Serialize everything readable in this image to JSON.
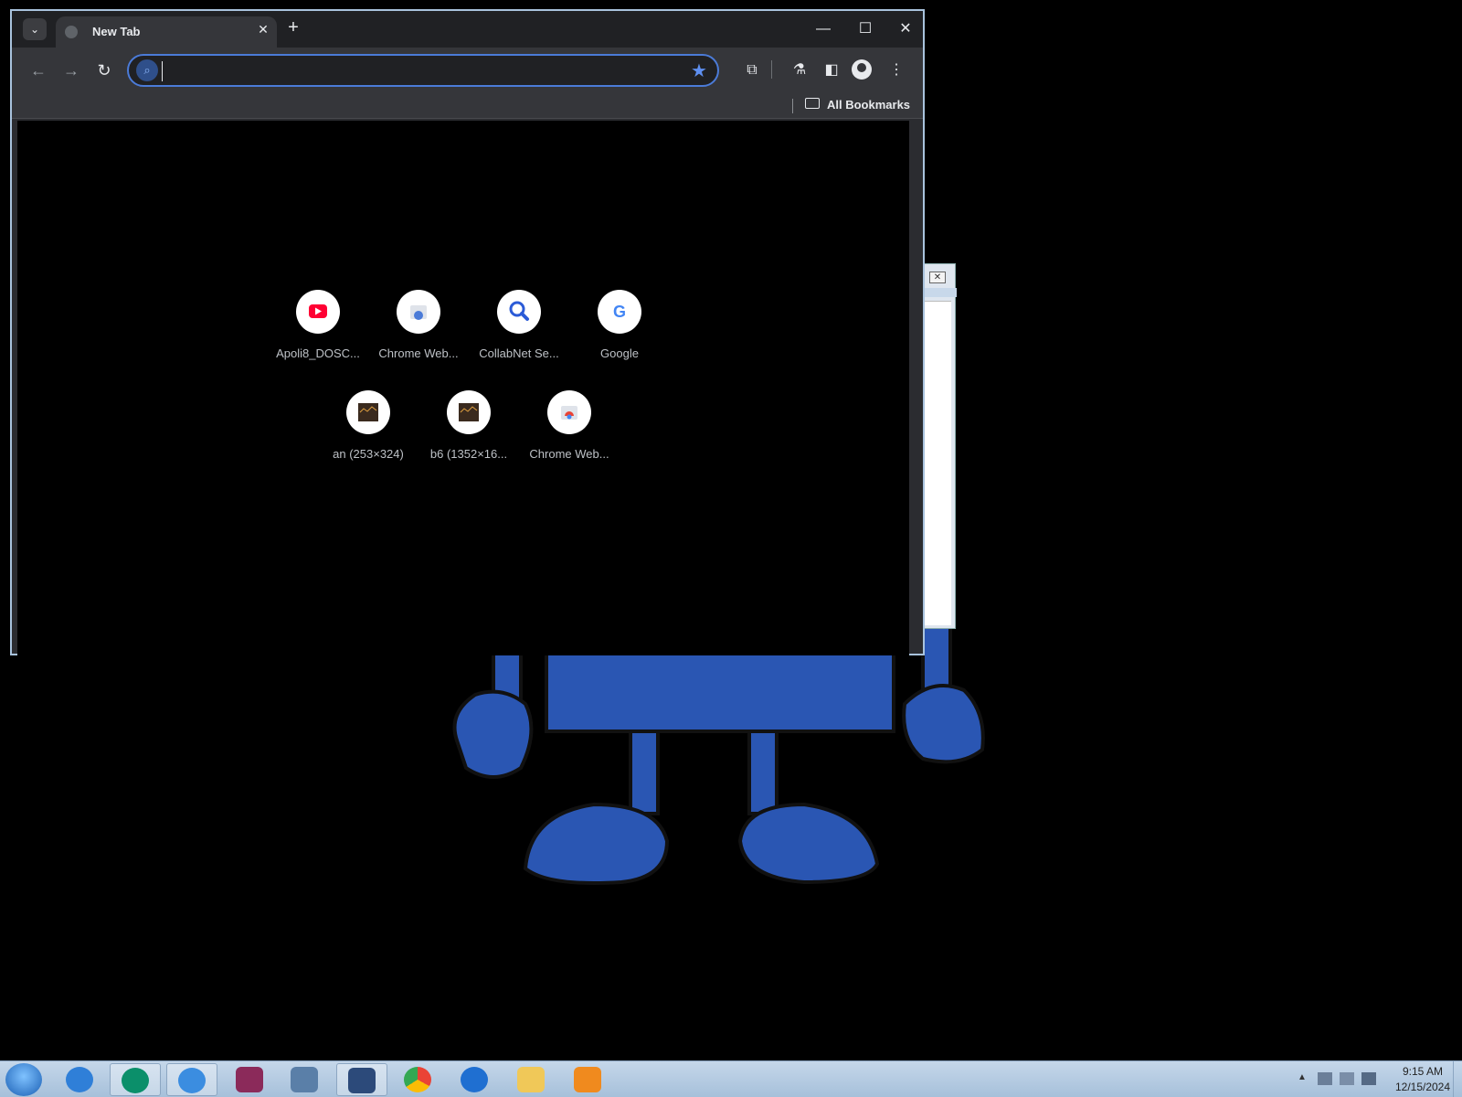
{
  "browser": {
    "tab": {
      "title": "New Tab",
      "close": "✕"
    },
    "new_tab": "+",
    "window_controls": {
      "minimize": "—",
      "maximize": "☐",
      "close": "✕"
    },
    "nav": {
      "back": "←",
      "forward": "→",
      "reload": "↻"
    },
    "omnibox": {
      "value": "",
      "placeholder": ""
    },
    "bookmarks_bar": {
      "all_bookmarks": "All Bookmarks"
    }
  },
  "shortcuts": [
    {
      "label": "Apoli8_DOSC...",
      "icon": "youtube-icon"
    },
    {
      "label": "Chrome Web...",
      "icon": "chrome-web-store-icon"
    },
    {
      "label": "CollabNet Se...",
      "icon": "search-icon"
    },
    {
      "label": "Google",
      "icon": "google-icon"
    },
    {
      "label": "an (253×324)",
      "icon": "image-thumbnail-icon"
    },
    {
      "label": "b6 (1352×16...",
      "icon": "image-thumbnail-icon"
    },
    {
      "label": "Chrome Web...",
      "icon": "chrome-web-store-icon"
    }
  ],
  "taskbar": {
    "apps": [
      "windows-start-icon",
      "internet-explorer-icon",
      "app-globe-icon",
      "internet-download-manager-icon",
      "winrar-icon",
      "computer-network-icon",
      "virtualbox-icon",
      "chrome-icon",
      "thunderbird-icon",
      "file-explorer-icon",
      "media-player-icon"
    ],
    "clock": {
      "time": "9:15 AM",
      "date": "12/15/2024"
    }
  },
  "colors": {
    "accent": "#4b7bd8",
    "mascot": "#2a56b3",
    "taskbar": "#b6cbe2"
  }
}
